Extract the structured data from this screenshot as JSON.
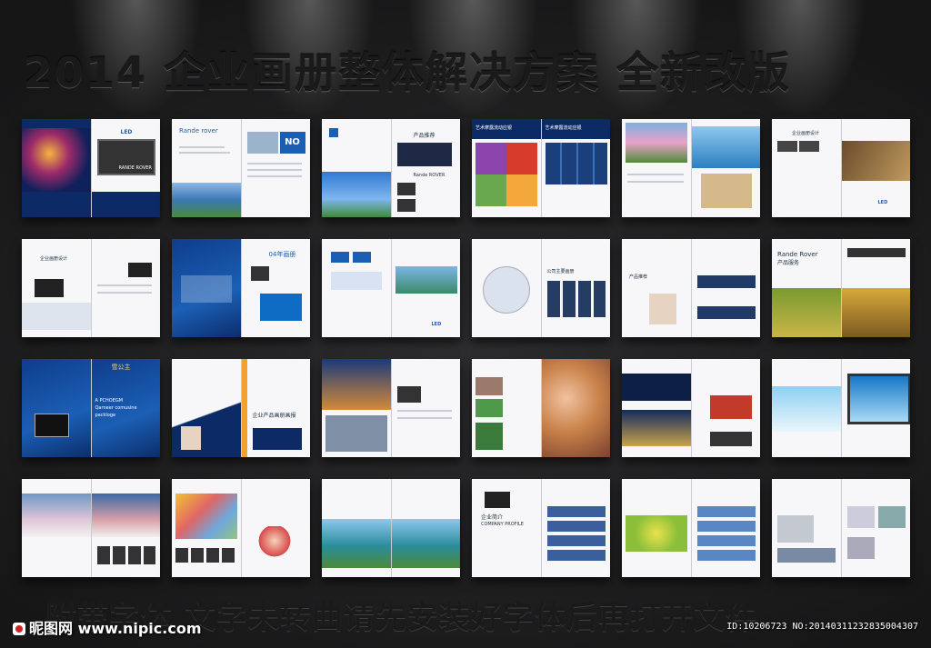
{
  "headline": "2014 企业画册整体解决方案  全新改版",
  "footer_note": "附带字体  文字未转曲请先安装好字体后再打开文件",
  "watermark": {
    "site": "昵图网 www.nipic.com",
    "id": "ID:10206723 NO:20140311232835004307"
  },
  "colors": {
    "accent": "#1b5fb5",
    "background": "#1e1e1f"
  },
  "spreads": [
    {
      "row": 1,
      "col": 1,
      "texts": [
        "LED",
        "RANDE ROVER"
      ]
    },
    {
      "row": 1,
      "col": 2,
      "texts": [
        "Rande rover",
        "NO"
      ]
    },
    {
      "row": 1,
      "col": 3,
      "texts": [
        "产品推荐",
        "Rande ROVER"
      ]
    },
    {
      "row": 1,
      "col": 4,
      "texts": [
        "艺术摩露流动应银",
        "艺术摩露流动应银"
      ]
    },
    {
      "row": 1,
      "col": 5,
      "texts": []
    },
    {
      "row": 1,
      "col": 6,
      "texts": [
        "企业画册设计",
        "LED"
      ]
    },
    {
      "row": 2,
      "col": 1,
      "texts": [
        "企业画册设计"
      ]
    },
    {
      "row": 2,
      "col": 2,
      "texts": [
        "04年画册"
      ]
    },
    {
      "row": 2,
      "col": 3,
      "texts": [
        "LED"
      ]
    },
    {
      "row": 2,
      "col": 4,
      "texts": [
        "公司主要画册"
      ]
    },
    {
      "row": 2,
      "col": 5,
      "texts": [
        "产品推荐"
      ]
    },
    {
      "row": 2,
      "col": 6,
      "texts": [
        "Rande Rover",
        "产品服务"
      ]
    },
    {
      "row": 3,
      "col": 1,
      "texts": [
        "雪公主",
        "A PCHOEGM",
        "Qarneer comusine",
        "packloge"
      ]
    },
    {
      "row": 3,
      "col": 2,
      "texts": [
        "企业产品画册画报"
      ]
    },
    {
      "row": 3,
      "col": 3,
      "texts": []
    },
    {
      "row": 3,
      "col": 4,
      "texts": []
    },
    {
      "row": 3,
      "col": 5,
      "texts": []
    },
    {
      "row": 3,
      "col": 6,
      "texts": []
    },
    {
      "row": 4,
      "col": 1,
      "texts": []
    },
    {
      "row": 4,
      "col": 2,
      "texts": []
    },
    {
      "row": 4,
      "col": 3,
      "texts": []
    },
    {
      "row": 4,
      "col": 4,
      "texts": [
        "企业简介",
        "COMPANY PROFILE"
      ]
    },
    {
      "row": 4,
      "col": 5,
      "texts": []
    },
    {
      "row": 4,
      "col": 6,
      "texts": []
    }
  ]
}
